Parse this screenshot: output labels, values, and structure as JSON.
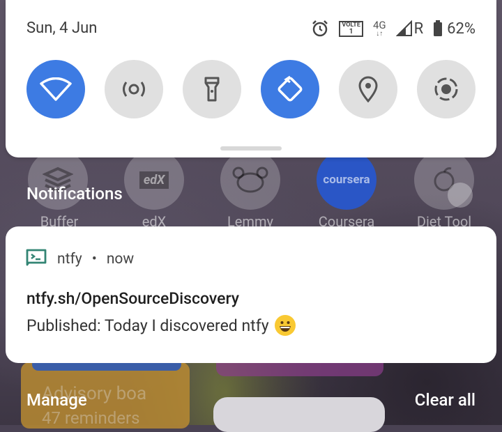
{
  "quick_settings": {
    "date": "Sun, 4 Jun",
    "status": {
      "volte_label": "VOLTE",
      "volte_sub": "1",
      "network_type": "4G",
      "roaming": "R",
      "battery": "62%"
    },
    "tiles": [
      {
        "name": "wifi",
        "icon": "wifi-icon",
        "active": true
      },
      {
        "name": "hotspot",
        "icon": "hotspot-icon",
        "active": false
      },
      {
        "name": "flashlight",
        "icon": "flashlight-icon",
        "active": false
      },
      {
        "name": "auto-rotate",
        "icon": "rotate-icon",
        "active": true
      },
      {
        "name": "location",
        "icon": "location-icon",
        "active": false
      },
      {
        "name": "screen-record",
        "icon": "record-icon",
        "active": false
      }
    ],
    "active_color": "#3d7be3"
  },
  "background_apps": [
    {
      "label": "Buffer"
    },
    {
      "label": "edX",
      "icon_text": "edX"
    },
    {
      "label": "Lemmy"
    },
    {
      "label": "Coursera",
      "icon_text": "coursera"
    },
    {
      "label": "Diet Tool"
    }
  ],
  "background_widget": {
    "text": "Advisory boa",
    "subtext": "47 reminders"
  },
  "notifications_header": "Notifications",
  "notification": {
    "app_name": "ntfy",
    "separator": "•",
    "time": "now",
    "title": "ntfy.sh/OpenSourceDiscovery",
    "body": "Published: Today I discovered ntfy",
    "accent_color": "#338574"
  },
  "footer": {
    "manage": "Manage",
    "clear_all": "Clear all"
  }
}
